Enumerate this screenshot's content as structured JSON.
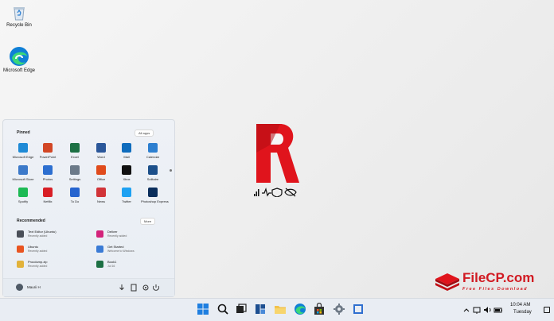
{
  "desktop": {
    "icons": [
      {
        "label": "Recycle Bin",
        "icon": "recycle-bin-icon"
      },
      {
        "label": "Microsoft Edge",
        "icon": "edge-icon"
      }
    ]
  },
  "center_logo": {
    "letter": "R",
    "status_icons": [
      "signal-icon",
      "pulse-icon",
      "shield-icon",
      "eye-off-icon"
    ]
  },
  "watermark": {
    "title": "FileCP.com",
    "subtitle": "Free Files Download"
  },
  "start_menu": {
    "pinned_title": "Pinned",
    "all_apps_label": "All apps",
    "pinned_apps": [
      {
        "label": "Microsoft Edge",
        "color": "#1f8ad6"
      },
      {
        "label": "PowerPoint",
        "color": "#d24726"
      },
      {
        "label": "Excel",
        "color": "#1d7044"
      },
      {
        "label": "Word",
        "color": "#2b579a"
      },
      {
        "label": "Mail",
        "color": "#0f6cbd"
      },
      {
        "label": "Calendar",
        "color": "#2d7fd0"
      },
      {
        "label": "Microsoft Store",
        "color": "#3c79c9"
      },
      {
        "label": "Photos",
        "color": "#2d6fd0"
      },
      {
        "label": "Settings",
        "color": "#6c7a89"
      },
      {
        "label": "Office",
        "color": "#e04b1c"
      },
      {
        "label": "Xbox",
        "color": "#111111"
      },
      {
        "label": "Solitaire",
        "color": "#1c4f8a"
      },
      {
        "label": "Spotify",
        "color": "#1db954"
      },
      {
        "label": "Netflix",
        "color": "#d81f26"
      },
      {
        "label": "To Do",
        "color": "#2564cf"
      },
      {
        "label": "News",
        "color": "#d13438"
      },
      {
        "label": "Twitter",
        "color": "#1da1f2"
      },
      {
        "label": "Photoshop Express",
        "color": "#0a2e5c"
      }
    ],
    "recommended_title": "Recommended",
    "more_label": "More",
    "recommended": [
      {
        "title": "Text Editor (Ubuntu)",
        "sub": "Recently added",
        "color": "#4a4f58"
      },
      {
        "title": "Deliver",
        "sub": "Recently added",
        "color": "#d3237a"
      },
      {
        "title": "Ubuntu",
        "sub": "Recently added",
        "color": "#e95420"
      },
      {
        "title": "Get Started",
        "sub": "Welcome to Windows",
        "color": "#3a7bd5"
      },
      {
        "title": "Procdump.zip",
        "sub": "Recently added",
        "color": "#e2b23a"
      },
      {
        "title": "Book1",
        "sub": "Jul 16",
        "color": "#1d7044"
      }
    ],
    "user_name": "Maurii H"
  },
  "taskbar": {
    "apps": [
      "windows-start-icon",
      "search-icon",
      "task-view-icon",
      "widgets-icon",
      "file-explorer-icon",
      "edge-icon",
      "store-icon",
      "settings-icon",
      "app-icon"
    ],
    "time": "10:04 AM",
    "day": "Tuesday"
  }
}
